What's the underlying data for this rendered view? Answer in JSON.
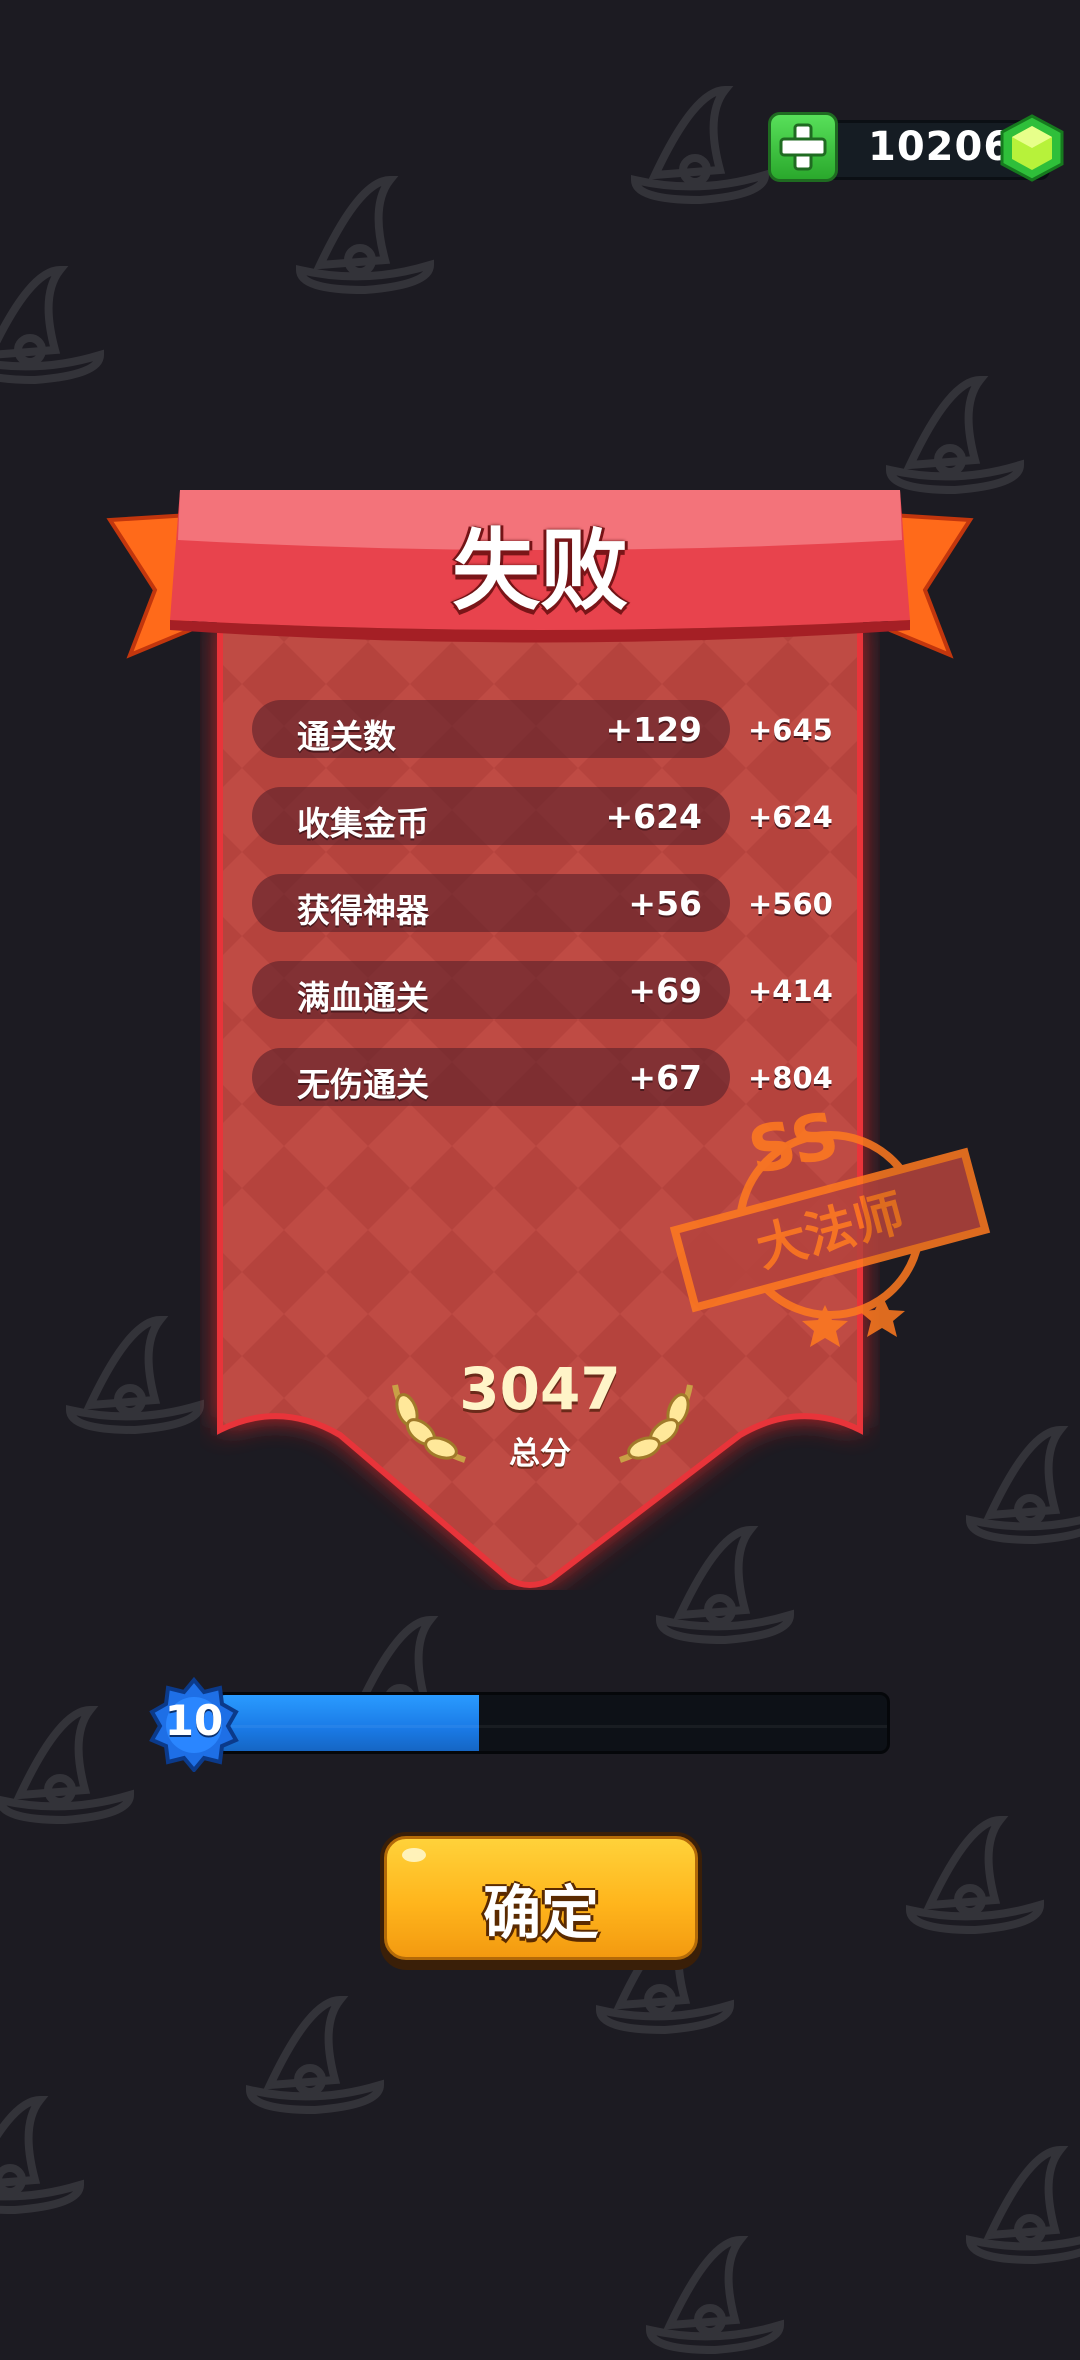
{
  "currency": {
    "amount": "10206",
    "add_icon": "plus-icon",
    "gem_icon": "green-gem-icon"
  },
  "result": {
    "title": "失败",
    "rows": [
      {
        "label": "通关数",
        "value": "+129",
        "points": "+645"
      },
      {
        "label": "收集金币",
        "value": "+624",
        "points": "+624"
      },
      {
        "label": "获得神器",
        "value": "+56",
        "points": "+560"
      },
      {
        "label": "满血通关",
        "value": "+69",
        "points": "+414"
      },
      {
        "label": "无伤通关",
        "value": "+67",
        "points": "+804"
      }
    ],
    "total": "3047",
    "total_label": "总分",
    "stamp": {
      "grade": "SS",
      "rank": "大法师"
    }
  },
  "level": {
    "number": "10",
    "progress": 0.39
  },
  "confirm_label": "确定",
  "colors": {
    "background": "#1c1b22",
    "banner_red": "#e8434d",
    "card_red": "#b8453f",
    "level_blue": "#1a7ae6",
    "button_yellow": "#ffb51c",
    "stamp_orange": "#ff7a1f"
  }
}
